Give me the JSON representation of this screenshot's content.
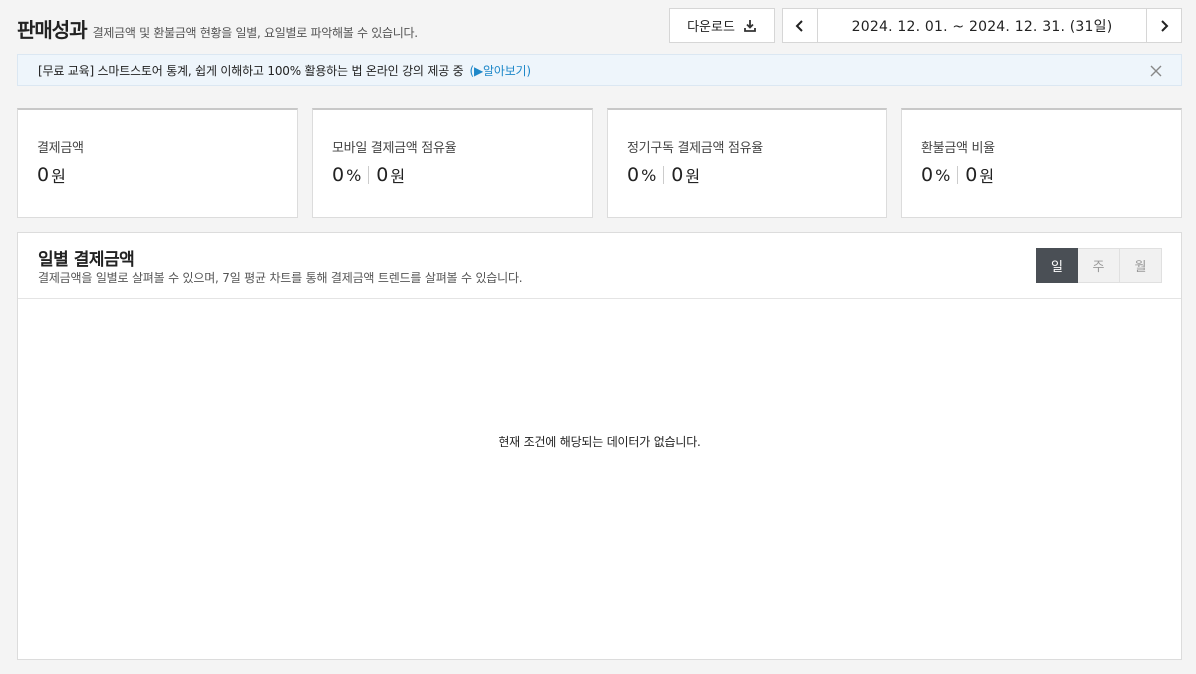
{
  "header": {
    "title": "판매성과",
    "description": "결제금액 및 환불금액 현황을 일별, 요일별로 파악해볼 수 있습니다."
  },
  "toolbar": {
    "download_label": "다운로드",
    "date_range": "2024. 12. 01. ~ 2024. 12. 31. (31일)"
  },
  "notice": {
    "text": "[무료 교육] 스마트스토어 통계, 쉽게 이해하고 100% 활용하는 법 온라인 강의 제공 중",
    "link_label": "(▶알아보기)"
  },
  "metrics": [
    {
      "label": "결제금액",
      "amount": "0",
      "amount_unit": "원"
    },
    {
      "label": "모바일 결제금액 점유율",
      "percent": "0",
      "percent_unit": "%",
      "amount": "0",
      "amount_unit": "원"
    },
    {
      "label": "정기구독 결제금액 점유율",
      "percent": "0",
      "percent_unit": "%",
      "amount": "0",
      "amount_unit": "원"
    },
    {
      "label": "환불금액 비율",
      "percent": "0",
      "percent_unit": "%",
      "amount": "0",
      "amount_unit": "원"
    }
  ],
  "daily_panel": {
    "title": "일별 결제금액",
    "description": "결제금액을 일별로 살펴볼 수 있으며, 7일 평균 차트를 통해 결제금액 트렌드를 살펴볼 수 있습니다.",
    "periods": [
      "일",
      "주",
      "월"
    ],
    "selected_period": "일",
    "empty_message": "현재 조건에 해당되는 데이터가 없습니다."
  },
  "colors": {
    "accent_link": "#1e88c9",
    "segment_active": "#4a4f55",
    "notice_bg": "#eef5fb"
  }
}
